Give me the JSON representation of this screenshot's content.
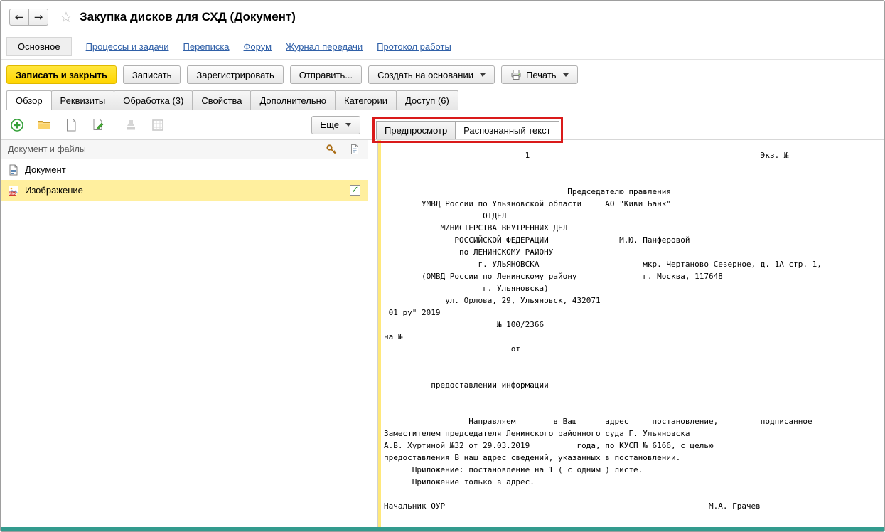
{
  "titlebar": {
    "title": "Закупка дисков для СХД (Документ)"
  },
  "icons": {
    "back": "←",
    "forward": "→",
    "star": "☆",
    "check": "✓",
    "png_badge": "PNG"
  },
  "nav": {
    "active_label": "Основное",
    "links": [
      {
        "label": "Процессы и задачи"
      },
      {
        "label": "Переписка"
      },
      {
        "label": "Форум"
      },
      {
        "label": "Журнал передачи"
      },
      {
        "label": "Протокол работы"
      }
    ]
  },
  "command_bar": {
    "buttons": {
      "save_and_close": "Записать и закрыть",
      "save": "Записать",
      "register": "Зарегистрировать",
      "send": "Отправить...",
      "create_on_basis": "Создать на основании",
      "print": "Печать"
    }
  },
  "section_tabs": [
    {
      "label": "Обзор",
      "active": true
    },
    {
      "label": "Реквизиты",
      "active": false
    },
    {
      "label": "Обработка (3)",
      "active": false
    },
    {
      "label": "Свойства",
      "active": false
    },
    {
      "label": "Дополнительно",
      "active": false
    },
    {
      "label": "Категории",
      "active": false
    },
    {
      "label": "Доступ (6)",
      "active": false
    }
  ],
  "files_panel": {
    "more_label": "Еще",
    "list_header": "Документ и файлы",
    "rows": [
      {
        "label": "Документ",
        "selected": false,
        "checked": false
      },
      {
        "label": "Изображение",
        "selected": true,
        "checked": true
      }
    ]
  },
  "preview_panel": {
    "tabs": [
      {
        "label": "Предпросмотр",
        "active": false
      },
      {
        "label": "Распознанный текст",
        "active": true
      }
    ],
    "ocr_text": "                              1                                                 Экз. №\n\n\n                                       Председателю правления\n        УМВД России по Ульяновской области     АО \"Киви Банк\"\n                     ОТДЕЛ\n            МИНИСТЕРСТВА ВНУТРЕННИХ ДЕЛ\n               РОССИЙСКОЙ ФЕДЕРАЦИИ               М.Ю. Панферовой\n                по ЛЕНИНСКОМУ РАЙОНУ\n                    г. УЛЬЯНОВСКА                      мкр. Чертаново Северное, д. 1А стр. 1,\n        (ОМВД России по Ленинскому району              г. Москва, 117648\n                     г. Ульяновска)\n             ул. Орлова, 29, Ульяновск, 432071\n 01 ру\" 2019\n                        № 100/2366\nна №\n                           от\n\n\n          предоставлении информации\n\n\n                  Направляем        в Ваш      адрес     постановление,         подписанное\nЗаместителем председателя Ленинского районного суда Г. Ульяновска\nА.В. Хуртиной №32 от 29.03.2019          года, по КУСП № 6166, с целью\nпредоставления В наш адрес сведений, указанных в постановлении.\n      Приложение: постановление на 1 ( с одним ) листе.\n      Приложение только в адрес.\n\nНачальник ОУР                                                        М.А. Грачев"
  },
  "colors": {
    "primary_button_yellow": "#ffd500",
    "selected_row_yellow": "#ffef9e",
    "annotation_red": "#da1a1a",
    "bottom_bar_teal": "#339b8e",
    "link_blue": "#3060a8"
  }
}
